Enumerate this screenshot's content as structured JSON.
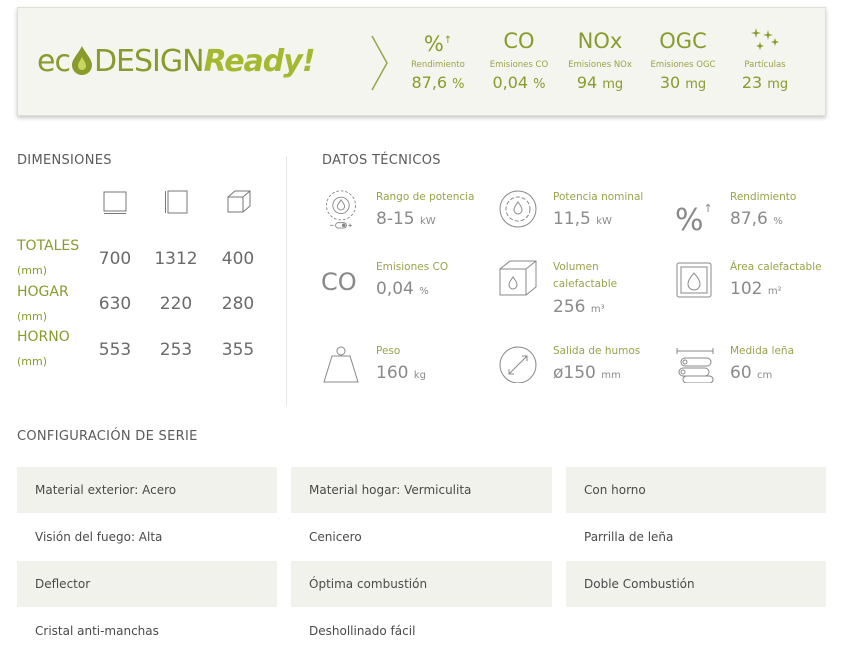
{
  "eco": {
    "logo": {
      "part1": "ec",
      "part2": "DESIGN",
      "part3": "Ready!"
    },
    "stats": [
      {
        "icon": "percent-up-icon",
        "symbol": "%",
        "label": "Rendimiento",
        "value": "87,6",
        "unit": "%"
      },
      {
        "icon": "co-icon",
        "symbol": "CO",
        "label": "Emisiones CO",
        "value": "0,04",
        "unit": "%"
      },
      {
        "icon": "nox-icon",
        "symbol": "NOx",
        "label": "Emisiones NOx",
        "value": "94",
        "unit": "mg"
      },
      {
        "icon": "ogc-icon",
        "symbol": "OGC",
        "label": "Emisiones OGC",
        "value": "30",
        "unit": "mg"
      },
      {
        "icon": "particles-icon",
        "symbol": "",
        "label": "Partículas",
        "value": "23",
        "unit": "mg"
      }
    ]
  },
  "dimensions": {
    "title": "DIMENSIONES",
    "icons": [
      "width-icon",
      "height-icon",
      "depth-icon"
    ],
    "rows": [
      {
        "label": "TOTALES",
        "unit": "(mm)",
        "values": [
          "700",
          "1312",
          "400"
        ]
      },
      {
        "label": "HOGAR",
        "unit": "(mm)",
        "values": [
          "630",
          "220",
          "280"
        ]
      },
      {
        "label": "HORNO",
        "unit": "(mm)",
        "values": [
          "553",
          "253",
          "355"
        ]
      }
    ]
  },
  "tech": {
    "title": "DATOS TÉCNICOS",
    "items": [
      {
        "icon": "power-range-icon",
        "label": "Rango de potencia",
        "value": "8-15",
        "unit": "kW"
      },
      {
        "icon": "nominal-power-icon",
        "label": "Potencia nominal",
        "value": "11,5",
        "unit": "kW"
      },
      {
        "icon": "efficiency-icon",
        "label": "Rendimiento",
        "value": "87,6",
        "unit": "%"
      },
      {
        "icon": "co-emissions-icon",
        "label": "Emisiones CO",
        "value": "0,04",
        "unit": "%",
        "symbol": "CO"
      },
      {
        "icon": "volume-icon",
        "label": "Volumen calefactable",
        "value": "256",
        "unit": "m³"
      },
      {
        "icon": "area-icon",
        "label": "Área calefactable",
        "value": "102",
        "unit": "m²"
      },
      {
        "icon": "weight-icon",
        "label": "Peso",
        "value": "160",
        "unit": "kg"
      },
      {
        "icon": "flue-outlet-icon",
        "label": "Salida de humos",
        "value": "ø150",
        "unit": "mm"
      },
      {
        "icon": "log-length-icon",
        "label": "Medida leña",
        "value": "60",
        "unit": "cm"
      }
    ]
  },
  "config": {
    "title": "CONFIGURACIÓN DE SERIE",
    "items": [
      "Material exterior: Acero",
      "Material hogar: Vermiculita",
      "Con horno",
      "Visión del fuego: Alta",
      "Cenicero",
      "Parrilla de leña",
      "Deflector",
      "Óptima combustión",
      "Doble Combustión",
      "Cristal anti-manchas",
      "Deshollinado fácil"
    ]
  },
  "colors": {
    "accent": "#8a9a2c",
    "accent_light": "#a4b830",
    "shade": "#f2f2ec",
    "label_green": "#9aa24a"
  }
}
